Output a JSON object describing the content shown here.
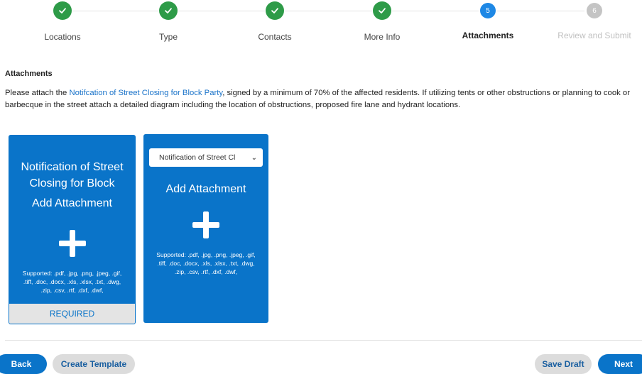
{
  "stepper": {
    "steps": [
      {
        "label": "Locations",
        "state": "done",
        "number": ""
      },
      {
        "label": "Type",
        "state": "done",
        "number": ""
      },
      {
        "label": "Contacts",
        "state": "done",
        "number": ""
      },
      {
        "label": "More Info",
        "state": "done",
        "number": ""
      },
      {
        "label": "Attachments",
        "state": "current",
        "number": "5"
      },
      {
        "label": "Review and Submit",
        "state": "pending",
        "number": "6"
      }
    ],
    "colors": {
      "done": "#2e9b48",
      "current": "#1e88e5",
      "pending": "#c4c4c4"
    }
  },
  "section": {
    "title": "Attachments"
  },
  "instructions": {
    "before_link": "Please attach the ",
    "link_text": "Notifcation of Street Closing for Block Party",
    "after_link": ", signed by a minimum of 70% of the affected residents. If utilizing tents or other obstructions or planning to cook or barbecque in the street attach a detailed diagram including the location of obstructions, proposed fire lane and hydrant locations."
  },
  "cards": [
    {
      "title": "Notification of Street Closing for Block",
      "action": "Add Attachment",
      "icon": "plus-icon",
      "supported": "Supported: .pdf, .jpg, .png, .jpeg, .gif, .tiff, .doc, .docx, .xls, .xlsx, .txt, .dwg, .zip, .csv, .rtf, .dxf, .dwf,",
      "badge": "REQUIRED"
    },
    {
      "select_value": "Notification of Street Cl",
      "action": "Add Attachment",
      "icon": "plus-icon",
      "supported": "Supported: .pdf, .jpg, .png, .jpeg, .gif, .tiff, .doc, .docx, .xls, .xlsx, .txt, .dwg, .zip, .csv, .rtf, .dxf, .dwf,"
    }
  ],
  "footer": {
    "back": "Back",
    "create_template": "Create Template",
    "save_draft": "Save Draft",
    "next": "Next"
  },
  "colors": {
    "accent": "#0a74c9",
    "link": "#1a73c9"
  }
}
